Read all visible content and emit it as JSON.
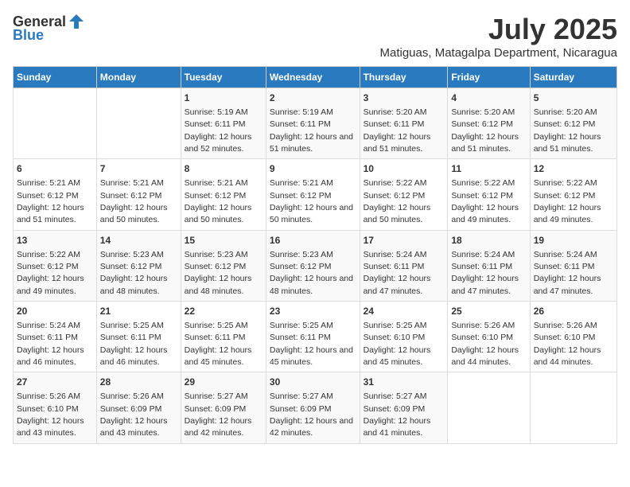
{
  "header": {
    "logo_general": "General",
    "logo_blue": "Blue",
    "month_title": "July 2025",
    "location": "Matiguas, Matagalpa Department, Nicaragua"
  },
  "weekdays": [
    "Sunday",
    "Monday",
    "Tuesday",
    "Wednesday",
    "Thursday",
    "Friday",
    "Saturday"
  ],
  "weeks": [
    [
      {
        "day": "",
        "sunrise": "",
        "sunset": "",
        "daylight": ""
      },
      {
        "day": "",
        "sunrise": "",
        "sunset": "",
        "daylight": ""
      },
      {
        "day": "1",
        "sunrise": "Sunrise: 5:19 AM",
        "sunset": "Sunset: 6:11 PM",
        "daylight": "Daylight: 12 hours and 52 minutes."
      },
      {
        "day": "2",
        "sunrise": "Sunrise: 5:19 AM",
        "sunset": "Sunset: 6:11 PM",
        "daylight": "Daylight: 12 hours and 51 minutes."
      },
      {
        "day": "3",
        "sunrise": "Sunrise: 5:20 AM",
        "sunset": "Sunset: 6:11 PM",
        "daylight": "Daylight: 12 hours and 51 minutes."
      },
      {
        "day": "4",
        "sunrise": "Sunrise: 5:20 AM",
        "sunset": "Sunset: 6:12 PM",
        "daylight": "Daylight: 12 hours and 51 minutes."
      },
      {
        "day": "5",
        "sunrise": "Sunrise: 5:20 AM",
        "sunset": "Sunset: 6:12 PM",
        "daylight": "Daylight: 12 hours and 51 minutes."
      }
    ],
    [
      {
        "day": "6",
        "sunrise": "Sunrise: 5:21 AM",
        "sunset": "Sunset: 6:12 PM",
        "daylight": "Daylight: 12 hours and 51 minutes."
      },
      {
        "day": "7",
        "sunrise": "Sunrise: 5:21 AM",
        "sunset": "Sunset: 6:12 PM",
        "daylight": "Daylight: 12 hours and 50 minutes."
      },
      {
        "day": "8",
        "sunrise": "Sunrise: 5:21 AM",
        "sunset": "Sunset: 6:12 PM",
        "daylight": "Daylight: 12 hours and 50 minutes."
      },
      {
        "day": "9",
        "sunrise": "Sunrise: 5:21 AM",
        "sunset": "Sunset: 6:12 PM",
        "daylight": "Daylight: 12 hours and 50 minutes."
      },
      {
        "day": "10",
        "sunrise": "Sunrise: 5:22 AM",
        "sunset": "Sunset: 6:12 PM",
        "daylight": "Daylight: 12 hours and 50 minutes."
      },
      {
        "day": "11",
        "sunrise": "Sunrise: 5:22 AM",
        "sunset": "Sunset: 6:12 PM",
        "daylight": "Daylight: 12 hours and 49 minutes."
      },
      {
        "day": "12",
        "sunrise": "Sunrise: 5:22 AM",
        "sunset": "Sunset: 6:12 PM",
        "daylight": "Daylight: 12 hours and 49 minutes."
      }
    ],
    [
      {
        "day": "13",
        "sunrise": "Sunrise: 5:22 AM",
        "sunset": "Sunset: 6:12 PM",
        "daylight": "Daylight: 12 hours and 49 minutes."
      },
      {
        "day": "14",
        "sunrise": "Sunrise: 5:23 AM",
        "sunset": "Sunset: 6:12 PM",
        "daylight": "Daylight: 12 hours and 48 minutes."
      },
      {
        "day": "15",
        "sunrise": "Sunrise: 5:23 AM",
        "sunset": "Sunset: 6:12 PM",
        "daylight": "Daylight: 12 hours and 48 minutes."
      },
      {
        "day": "16",
        "sunrise": "Sunrise: 5:23 AM",
        "sunset": "Sunset: 6:12 PM",
        "daylight": "Daylight: 12 hours and 48 minutes."
      },
      {
        "day": "17",
        "sunrise": "Sunrise: 5:24 AM",
        "sunset": "Sunset: 6:11 PM",
        "daylight": "Daylight: 12 hours and 47 minutes."
      },
      {
        "day": "18",
        "sunrise": "Sunrise: 5:24 AM",
        "sunset": "Sunset: 6:11 PM",
        "daylight": "Daylight: 12 hours and 47 minutes."
      },
      {
        "day": "19",
        "sunrise": "Sunrise: 5:24 AM",
        "sunset": "Sunset: 6:11 PM",
        "daylight": "Daylight: 12 hours and 47 minutes."
      }
    ],
    [
      {
        "day": "20",
        "sunrise": "Sunrise: 5:24 AM",
        "sunset": "Sunset: 6:11 PM",
        "daylight": "Daylight: 12 hours and 46 minutes."
      },
      {
        "day": "21",
        "sunrise": "Sunrise: 5:25 AM",
        "sunset": "Sunset: 6:11 PM",
        "daylight": "Daylight: 12 hours and 46 minutes."
      },
      {
        "day": "22",
        "sunrise": "Sunrise: 5:25 AM",
        "sunset": "Sunset: 6:11 PM",
        "daylight": "Daylight: 12 hours and 45 minutes."
      },
      {
        "day": "23",
        "sunrise": "Sunrise: 5:25 AM",
        "sunset": "Sunset: 6:11 PM",
        "daylight": "Daylight: 12 hours and 45 minutes."
      },
      {
        "day": "24",
        "sunrise": "Sunrise: 5:25 AM",
        "sunset": "Sunset: 6:10 PM",
        "daylight": "Daylight: 12 hours and 45 minutes."
      },
      {
        "day": "25",
        "sunrise": "Sunrise: 5:26 AM",
        "sunset": "Sunset: 6:10 PM",
        "daylight": "Daylight: 12 hours and 44 minutes."
      },
      {
        "day": "26",
        "sunrise": "Sunrise: 5:26 AM",
        "sunset": "Sunset: 6:10 PM",
        "daylight": "Daylight: 12 hours and 44 minutes."
      }
    ],
    [
      {
        "day": "27",
        "sunrise": "Sunrise: 5:26 AM",
        "sunset": "Sunset: 6:10 PM",
        "daylight": "Daylight: 12 hours and 43 minutes."
      },
      {
        "day": "28",
        "sunrise": "Sunrise: 5:26 AM",
        "sunset": "Sunset: 6:09 PM",
        "daylight": "Daylight: 12 hours and 43 minutes."
      },
      {
        "day": "29",
        "sunrise": "Sunrise: 5:27 AM",
        "sunset": "Sunset: 6:09 PM",
        "daylight": "Daylight: 12 hours and 42 minutes."
      },
      {
        "day": "30",
        "sunrise": "Sunrise: 5:27 AM",
        "sunset": "Sunset: 6:09 PM",
        "daylight": "Daylight: 12 hours and 42 minutes."
      },
      {
        "day": "31",
        "sunrise": "Sunrise: 5:27 AM",
        "sunset": "Sunset: 6:09 PM",
        "daylight": "Daylight: 12 hours and 41 minutes."
      },
      {
        "day": "",
        "sunrise": "",
        "sunset": "",
        "daylight": ""
      },
      {
        "day": "",
        "sunrise": "",
        "sunset": "",
        "daylight": ""
      }
    ]
  ]
}
